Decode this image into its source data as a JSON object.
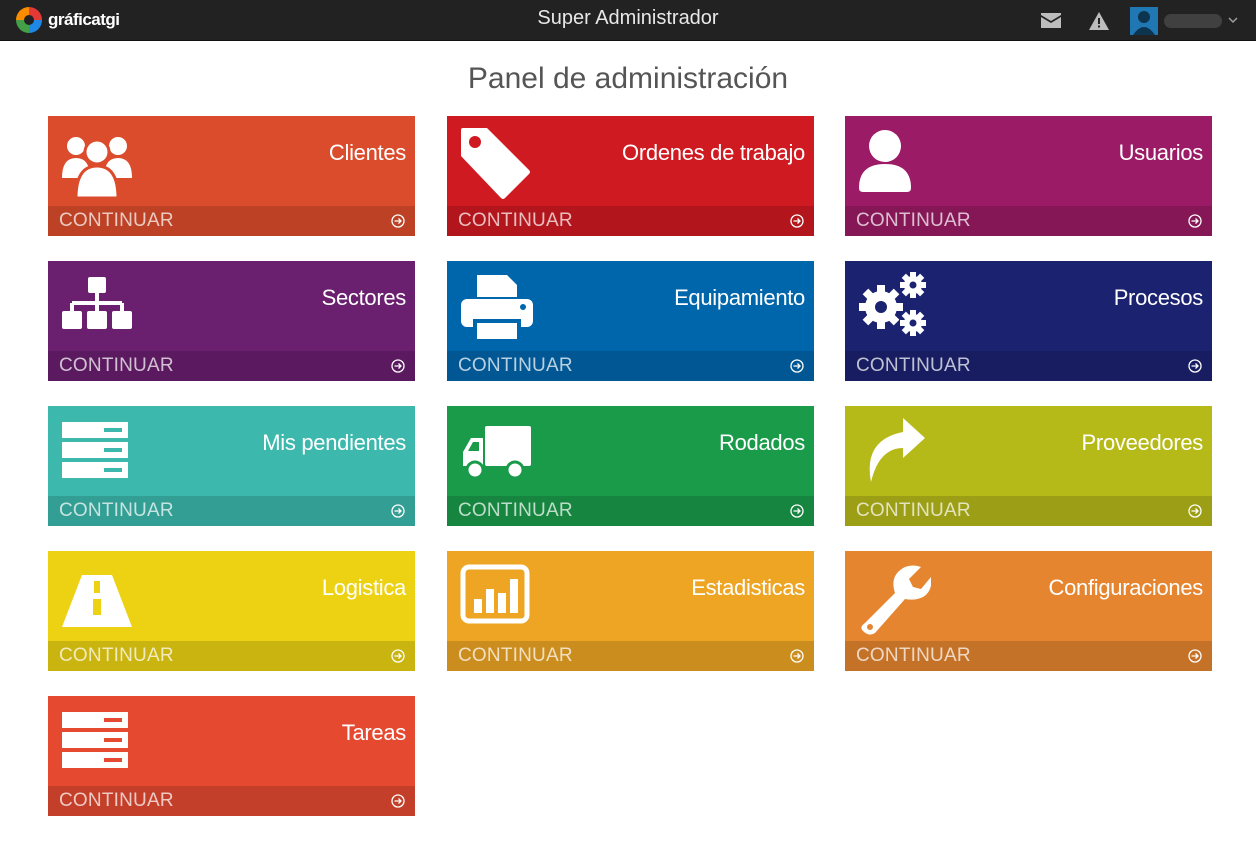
{
  "header": {
    "brand": "gráficatgi",
    "title": "Super Administrador"
  },
  "page": {
    "title": "Panel de administración"
  },
  "tiles": [
    {
      "label": "Clientes",
      "action": "CONTINUAR",
      "color": "#db4c2c",
      "icon": "users-icon"
    },
    {
      "label": "Ordenes de trabajo",
      "action": "CONTINUAR",
      "color": "#d01a21",
      "icon": "tag-icon"
    },
    {
      "label": "Usuarios",
      "action": "CONTINUAR",
      "color": "#9c1b66",
      "icon": "user-icon"
    },
    {
      "label": "Sectores",
      "action": "CONTINUAR",
      "color": "#6b1f6f",
      "icon": "sitemap-icon"
    },
    {
      "label": "Equipamiento",
      "action": "CONTINUAR",
      "color": "#0066ac",
      "icon": "printer-icon"
    },
    {
      "label": "Procesos",
      "action": "CONTINUAR",
      "color": "#1b2270",
      "icon": "gears-icon"
    },
    {
      "label": "Mis pendientes",
      "action": "CONTINUAR",
      "color": "#3cb8ad",
      "icon": "server-icon"
    },
    {
      "label": "Rodados",
      "action": "CONTINUAR",
      "color": "#1a9b4a",
      "icon": "truck-icon"
    },
    {
      "label": "Proveedores",
      "action": "CONTINUAR",
      "color": "#b6ba19",
      "icon": "share-icon"
    },
    {
      "label": "Logistica",
      "action": "CONTINUAR",
      "color": "#ecd212",
      "icon": "road-icon"
    },
    {
      "label": "Estadisticas",
      "action": "CONTINUAR",
      "color": "#eda523",
      "icon": "bar-chart-icon"
    },
    {
      "label": "Configuraciones",
      "action": "CONTINUAR",
      "color": "#e68530",
      "icon": "wrench-icon"
    },
    {
      "label": "Tareas",
      "action": "CONTINUAR",
      "color": "#e54a30",
      "icon": "server-icon"
    }
  ]
}
